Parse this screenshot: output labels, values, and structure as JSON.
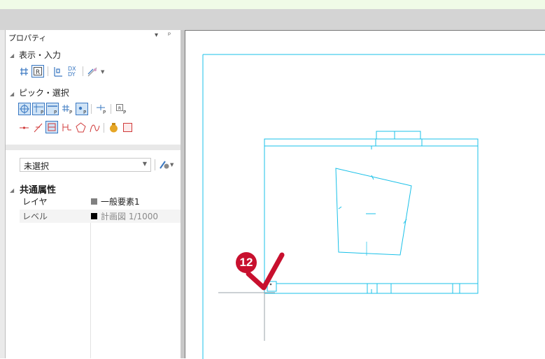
{
  "panel": {
    "title": "プロパティ",
    "pin_label": "▾",
    "pin_icon_glyph": "ᵖ",
    "sections": {
      "display_input": "表示・入力",
      "pick_select": "ピック・選択"
    },
    "selection": {
      "value": "未選択"
    },
    "common_attributes": {
      "heading": "共通属性",
      "rows": [
        {
          "key": "レイヤ",
          "value": "一般要素1",
          "swatch": "#808080"
        },
        {
          "key": "レベル",
          "value": "計画図 1/1000",
          "swatch": "#000000"
        }
      ]
    },
    "dxdy_label": "DX\nDY"
  },
  "annotation": {
    "step_number": "12",
    "accent_color": "#c8102e",
    "checkmark": "check-icon"
  },
  "colors": {
    "drawing_line": "#19c0e8",
    "icon_blue": "#3a78c2",
    "icon_red": "#d03a3a",
    "toolbar_gray": "#d4d4d4",
    "top_band": "#f0fbe7"
  }
}
